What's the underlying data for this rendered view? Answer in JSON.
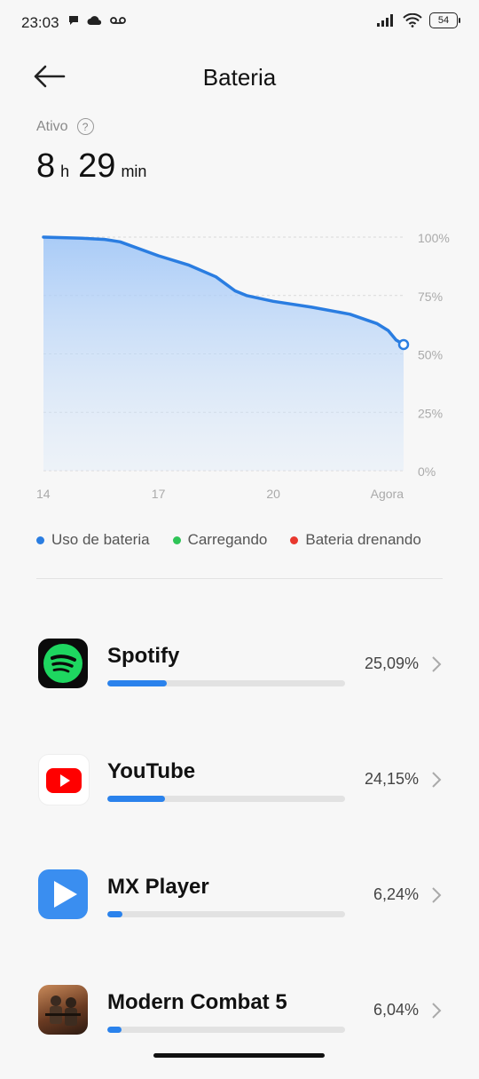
{
  "status": {
    "time": "23:03",
    "battery": "54"
  },
  "header": {
    "title": "Bateria"
  },
  "active": {
    "label": "Ativo",
    "hours": "8",
    "hours_unit": "h",
    "minutes": "29",
    "minutes_unit": "min"
  },
  "chart_data": {
    "type": "area",
    "x": [
      "14",
      "17",
      "20",
      "Agora"
    ],
    "y_ticks": [
      "100%",
      "75%",
      "50%",
      "25%",
      "0%"
    ],
    "ylim": [
      0,
      100
    ],
    "series": [
      {
        "name": "Uso de bateria",
        "color": "#2a7de1",
        "points": [
          [
            14,
            100
          ],
          [
            15,
            99.5
          ],
          [
            15.6,
            99
          ],
          [
            16,
            98
          ],
          [
            17,
            92
          ],
          [
            17.8,
            88
          ],
          [
            18.5,
            83
          ],
          [
            19,
            77
          ],
          [
            19.3,
            75
          ],
          [
            20,
            72.5
          ],
          [
            21,
            70
          ],
          [
            22,
            67
          ],
          [
            22.7,
            63
          ],
          [
            23,
            60
          ],
          [
            23.2,
            56
          ],
          [
            23.4,
            54
          ]
        ]
      }
    ]
  },
  "legend": [
    {
      "label": "Uso de bateria",
      "color": "#2a7de1"
    },
    {
      "label": "Carregando",
      "color": "#2fc457"
    },
    {
      "label": "Bateria drenando",
      "color": "#e8382e"
    }
  ],
  "apps": [
    {
      "name": "Spotify",
      "percent": "25,09%",
      "fraction": 0.2509,
      "icon": "spotify-icon"
    },
    {
      "name": "YouTube",
      "percent": "24,15%",
      "fraction": 0.2415,
      "icon": "youtube-icon"
    },
    {
      "name": "MX Player",
      "percent": "6,24%",
      "fraction": 0.0624,
      "icon": "mx-player-icon"
    },
    {
      "name": "Modern Combat 5",
      "percent": "6,04%",
      "fraction": 0.0604,
      "icon": "modern-combat-icon"
    }
  ]
}
